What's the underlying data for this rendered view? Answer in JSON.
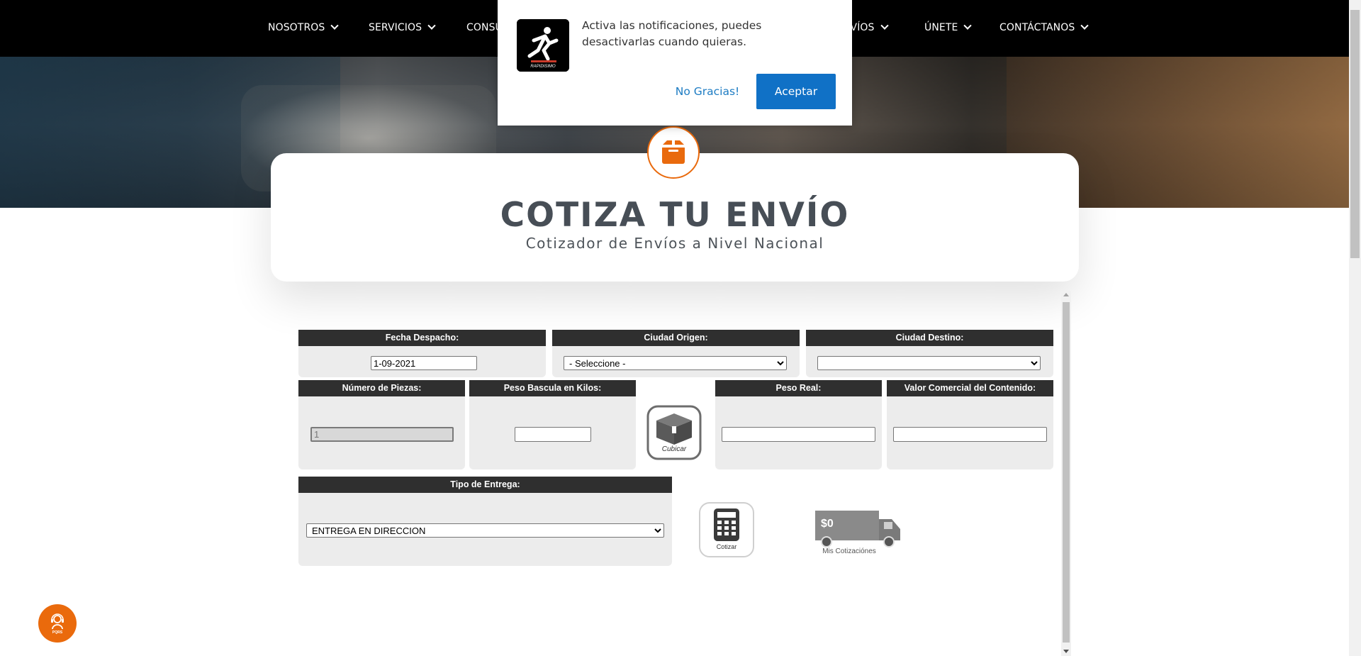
{
  "nav": {
    "items": [
      {
        "label": "NOSOTROS"
      },
      {
        "label": "SERVICIOS"
      },
      {
        "label": "CONSU"
      },
      {
        "label": "ENVÍOS"
      },
      {
        "label": "ÚNETE"
      },
      {
        "label": "CONTÁCTANOS"
      }
    ]
  },
  "header": {
    "title": "COTIZA TU ENVÍO",
    "subtitle": "Cotizador de Envíos a Nivel Nacional"
  },
  "form": {
    "fecha": {
      "label": "Fecha Despacho:",
      "value": "1-09-2021"
    },
    "origen": {
      "label": "Ciudad Origen:",
      "selected": "- Seleccione -"
    },
    "destino": {
      "label": "Ciudad Destino:",
      "selected": ""
    },
    "piezas": {
      "label": "Número de Piezas:",
      "value": "1"
    },
    "peso_bascula": {
      "label": "Peso Bascula en Kilos:",
      "value": ""
    },
    "cubicar": {
      "label": "Cubicar"
    },
    "peso_real": {
      "label": "Peso Real:",
      "value": ""
    },
    "valor": {
      "label": "Valor Comercial del Contenido:",
      "value": ""
    },
    "tipo_entrega": {
      "label": "Tipo de Entrega:",
      "selected": "ENTREGA EN DIRECCION"
    },
    "cotizar": {
      "label": "Cotizar"
    },
    "mis_cotizaciones": {
      "amount": "$0",
      "label": "Mis Cotizaciónes"
    }
  },
  "notification": {
    "message": "Activa las notificaciones, puedes desactivarlas cuando quieras.",
    "decline": "No Gracias!",
    "accept": "Aceptar",
    "logo_text": "RAPIDISIMO"
  },
  "pqrs": {
    "label": "PQRS"
  },
  "colors": {
    "accent": "#e96a0d",
    "nav_bg": "#000000",
    "header_bg": "#2f2f2f",
    "panel_bg": "#ececec",
    "primary_button": "#1071c6"
  }
}
